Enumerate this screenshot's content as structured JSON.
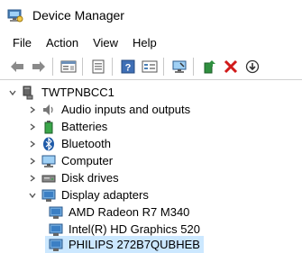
{
  "window": {
    "title": "Device Manager"
  },
  "menu": [
    "File",
    "Action",
    "View",
    "Help"
  ],
  "toolbar": [
    "back",
    "forward",
    "properties",
    "update",
    "help",
    "show-hidden",
    "scan",
    "add-legacy",
    "uninstall",
    "disable"
  ],
  "tree": {
    "root": "TWTPNBCC1",
    "categories": [
      "Audio inputs and outputs",
      "Batteries",
      "Bluetooth",
      "Computer",
      "Disk drives",
      "Display adapters"
    ],
    "display_adapters": [
      "AMD Radeon R7 M340",
      "Intel(R) HD Graphics 520",
      "PHILIPS 272B7QUBHEB"
    ]
  },
  "icons": {
    "root": "computer-icon",
    "audio": "speaker-icon",
    "batteries": "battery-icon",
    "bluetooth": "bluetooth-icon",
    "computer": "monitor-icon",
    "disk": "disk-drive-icon",
    "display": "display-adapter-icon"
  }
}
